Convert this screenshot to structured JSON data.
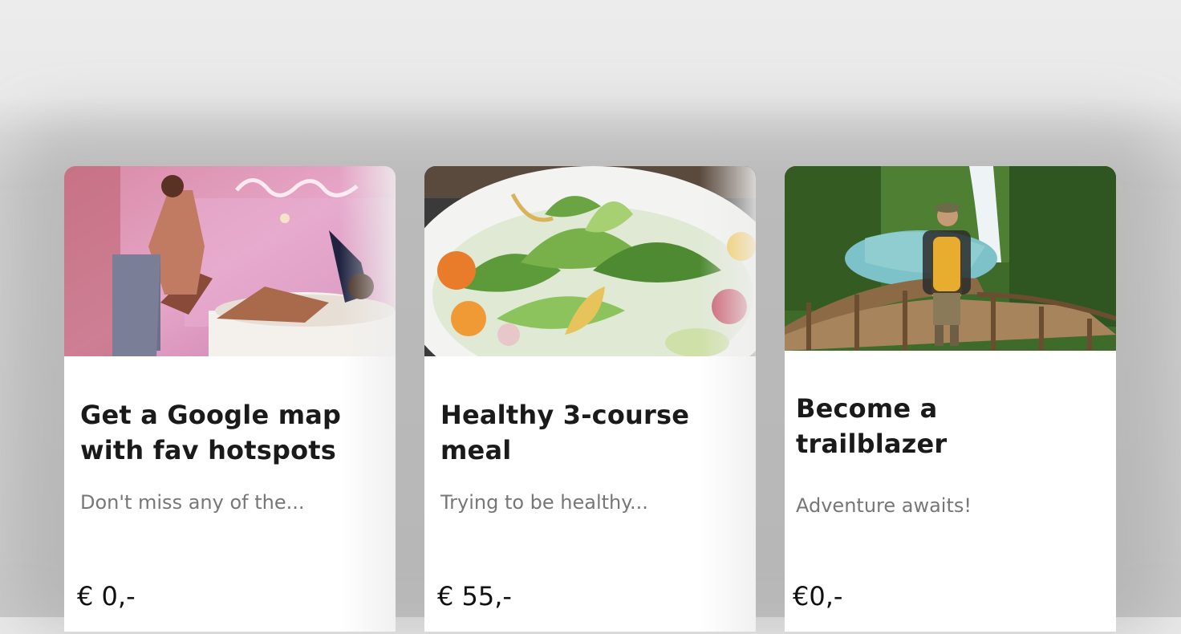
{
  "cards": [
    {
      "title": "Get a Google map with fav hotspots",
      "description": "Don't miss any of the...",
      "price": "€ 0,-",
      "image": "party-bathtub-photo"
    },
    {
      "title": "Healthy 3-course meal",
      "description": "Trying to be healthy...",
      "price": "€ 55,-",
      "image": "salad-plate-photo"
    },
    {
      "title": "Become a trailblazer",
      "description": "Adventure awaits!",
      "price": "€0,-",
      "image": "waterfall-hiker-photo"
    }
  ],
  "colors": {
    "background": "#e9e9e9",
    "card": "#ffffff",
    "title": "#1a1a1a",
    "description": "#777777"
  }
}
